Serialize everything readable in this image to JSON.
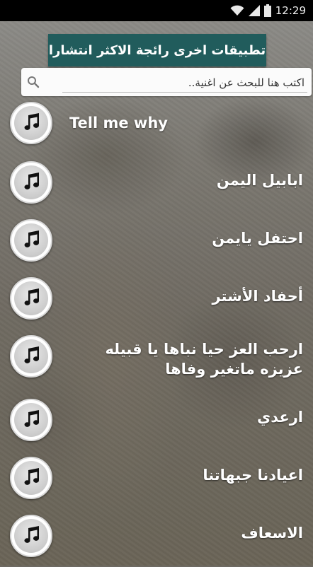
{
  "status_bar": {
    "time": "12:29"
  },
  "banner": {
    "label": "تطبيقات اخرى رائجة الاكثر انتشارا"
  },
  "search": {
    "placeholder": "اكتب هنا للبحث عن اغنية.."
  },
  "songs": [
    {
      "title": "Tell me why"
    },
    {
      "title": "ابابيل اليمن"
    },
    {
      "title": "احتفل يايمن"
    },
    {
      "title": "أحفاد الأشتر"
    },
    {
      "title": "ارحب العز حيا نباها يا قبيله عزيزه ماتغير وفاها"
    },
    {
      "title": "ارعدي"
    },
    {
      "title": "اعيادنا جبهاتنا"
    },
    {
      "title": "الاسعاف"
    }
  ],
  "icons": {
    "song": "music-note-icon",
    "search": "search-icon",
    "wifi": "wifi-icon",
    "signal": "signal-icon",
    "battery": "battery-icon"
  },
  "colors": {
    "banner_bg": "#215c5c",
    "status_bar_bg": "#000000",
    "title_text": "#ffffff"
  }
}
